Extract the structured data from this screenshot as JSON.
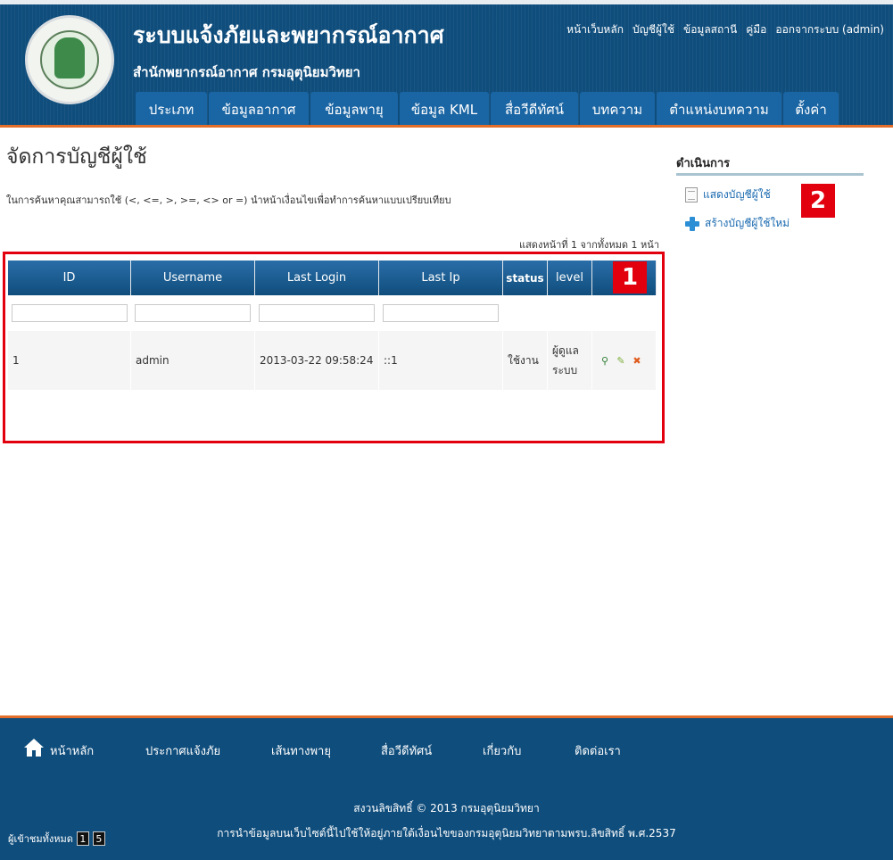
{
  "header": {
    "title": "ระบบแจ้งภัยและพยากรณ์อากาศ",
    "subtitle": "สำนักพยากรณ์อากาศ กรมอุตุนิยมวิทยา",
    "logo_text": "METEOROLOGICAL DEPARTMENT",
    "top_links": [
      "หน้าเว็บหลัก",
      "บัญชีผู้ใช้",
      "ข้อมูลสถานี",
      "คู่มือ",
      "ออกจากระบบ (admin)"
    ],
    "nav_tabs": [
      "ประเภท",
      "ข้อมูลอากาศ",
      "ข้อมูลพายุ",
      "ข้อมูล KML",
      "สื่อวีดีทัศน์",
      "บทความ",
      "ตำแหน่งบทความ",
      "ตั้งค่า"
    ]
  },
  "main": {
    "page_title": "จัดการบัญชีผู้ใช้",
    "search_hint": "ในการค้นหาคุณสามารถใช้ (<, <=, >, >=, <> or =) นำหน้าเงื่อนไขเพื่อทำการค้นหาแบบเปรียบเทียบ",
    "summary": "แสดงหน้าที่ 1 จากทั้งหมด 1 หน้า",
    "columns": [
      "ID",
      "Username",
      "Last Login",
      "Last Ip",
      "status",
      "level"
    ],
    "rows": [
      {
        "id": "1",
        "username": "admin",
        "last_login": "2013-03-22 09:58:24",
        "last_ip": "::1",
        "status": "ใช้งาน",
        "level": "ผู้ดูแลระบบ"
      }
    ]
  },
  "sidebar": {
    "title": "ดำเนินการ",
    "items": [
      {
        "label": "แสดงบัญชีผู้ใช้",
        "icon": "list-icon"
      },
      {
        "label": "สร้างบัญชีผู้ใช้ใหม่",
        "icon": "plus-icon"
      }
    ]
  },
  "badges": {
    "one": "1",
    "two": "2"
  },
  "footer": {
    "nav": [
      "หน้าหลัก",
      "ประกาศแจ้งภัย",
      "เส้นทางพายุ",
      "สื่อวีดีทัศน์",
      "เกี่ยวกับ",
      "ติดต่อเรา"
    ],
    "copyright": "สงวนลิขสิทธิ์ © 2013 กรมอุตุนิยมวิทยา",
    "terms": "การนำข้อมูลบนเว็บไซต์นี้ไปใช้ให้อยู่ภายใต้เงื่อนไขของกรมอุตุนิยมวิทยาตามพรบ.ลิขสิทธิ์ พ.ศ.2537",
    "visitors_label": "ผู้เข้าชมทั้งหมด",
    "visitor_digits": [
      "1",
      "5"
    ]
  },
  "colors": {
    "header_bg": "#0f4d7c",
    "accent_orange": "#e36e2a",
    "highlight_red": "#e2000f",
    "link_blue": "#1a6ab0"
  }
}
